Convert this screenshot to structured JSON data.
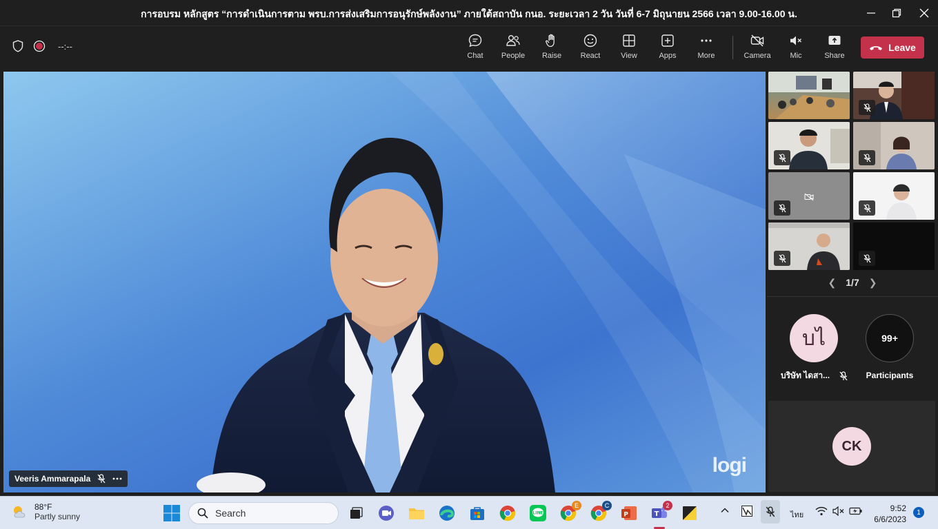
{
  "window": {
    "title": "การอบรม หลักสูตร “การดำเนินการตาม พรบ.การส่งเสริมการอนุรักษ์พลังงาน” ภายใต้สถาบัน กนอ. ระยะเวลา 2 วัน วันที่ 6-7 มิถุนายน 2566 เวลา 9.00-16.00 น."
  },
  "toolbar": {
    "timer": "--:--",
    "chat": "Chat",
    "people": "People",
    "raise": "Raise",
    "react": "React",
    "view": "View",
    "apps": "Apps",
    "more": "More",
    "camera": "Camera",
    "mic": "Mic",
    "share": "Share",
    "leave": "Leave",
    "leave_color": "#c4314b"
  },
  "main_video": {
    "speaker_name": "Veeris Ammarapala",
    "watermark": "logi"
  },
  "gallery": {
    "pager": "1/7"
  },
  "participants_panel": {
    "avatar_initials": "บไ",
    "avatar_name": "บริษัท ไดสา...",
    "count_badge": "99+",
    "participants_label": "Participants",
    "ck_initials": "CK"
  },
  "taskbar": {
    "weather_temp": "88°F",
    "weather_desc": "Partly sunny",
    "search_label": "Search",
    "teams_badge": "2",
    "lang": "ไทย",
    "time": "9:52",
    "date": "6/6/2023",
    "notifications": "1"
  },
  "colors": {
    "accent_red": "#c4314b",
    "avatar_bg": "#f3d9e2",
    "taskbar_bg": "#dde6f2"
  }
}
